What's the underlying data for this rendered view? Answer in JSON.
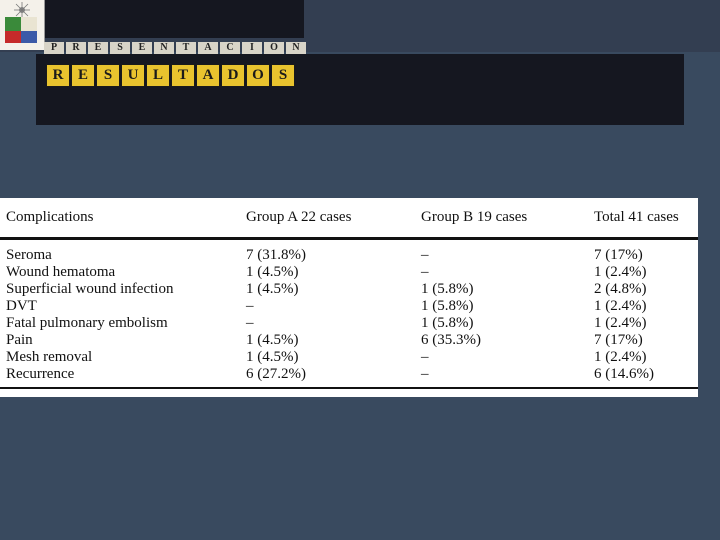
{
  "header": {
    "subtitle_letters": [
      "P",
      "R",
      "E",
      "S",
      "E",
      "N",
      "T",
      "A",
      "C",
      "I",
      "O",
      "N"
    ],
    "title_letters": [
      "R",
      "E",
      "S",
      "U",
      "L",
      "T",
      "A",
      "D",
      "O",
      "S"
    ]
  },
  "table": {
    "columns": [
      "Complications",
      "Group A 22 cases",
      "Group B 19 cases",
      "Total 41 cases"
    ],
    "rows": [
      [
        "Seroma",
        "7 (31.8%)",
        "–",
        "7 (17%)"
      ],
      [
        "Wound hematoma",
        "1 (4.5%)",
        "–",
        "1 (2.4%)"
      ],
      [
        "Superficial wound infection",
        "1 (4.5%)",
        "1 (5.8%)",
        "2 (4.8%)"
      ],
      [
        "DVT",
        "–",
        "1 (5.8%)",
        "1 (2.4%)"
      ],
      [
        "Fatal pulmonary embolism",
        "–",
        "1 (5.8%)",
        "1 (2.4%)"
      ],
      [
        "Pain",
        "1 (4.5%)",
        "6 (35.3%)",
        "7 (17%)"
      ],
      [
        "Mesh removal",
        "1 (4.5%)",
        "–",
        "1 (2.4%)"
      ],
      [
        "Recurrence",
        "6 (27.2%)",
        "–",
        "6 (14.6%)"
      ]
    ]
  }
}
